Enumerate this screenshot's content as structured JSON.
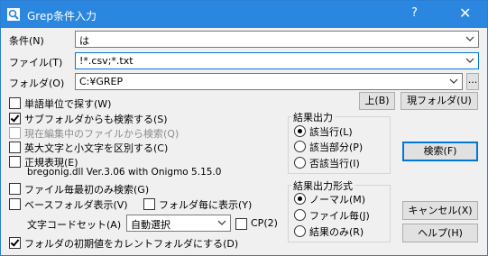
{
  "window": {
    "title": "Grep条件入力",
    "help_glyph": "?",
    "close_glyph": "✕",
    "accent": "#2b86e0"
  },
  "fields": {
    "condition_label": "条件(N)",
    "condition_value": "は",
    "file_label": "ファイル(T)",
    "file_value": "!*.csv;*.txt",
    "folder_label": "フォルダ(O)",
    "folder_value": "C:¥GREP",
    "browse_label": "..."
  },
  "buttons": {
    "up": "上(B)",
    "current_folder": "現フォルダ(U)",
    "search": "検索(F)",
    "cancel": "キャンセル(X)",
    "help": "ヘルプ(H)"
  },
  "options": {
    "word_unit": {
      "label": "単語単位で探す(W)",
      "checked": false
    },
    "subfolder": {
      "label": "サブフォルダからも検索する(S)",
      "checked": true
    },
    "from_editing": {
      "label": "現在編集中のファイルから検索(Q)",
      "checked": false,
      "disabled": true
    },
    "case": {
      "label": "英大文字と小文字を区別する(C)",
      "checked": false
    },
    "regex": {
      "label": "正規表現(E)",
      "checked": false
    },
    "regex_lib": "bregonig.dll Ver.3.06 with Onigmo 5.15.0",
    "first_match": {
      "label": "ファイル毎最初のみ検索(G)",
      "checked": false
    },
    "base_folder": {
      "label": "ベースフォルダ表示(V)",
      "checked": false
    },
    "per_folder": {
      "label": "フォルダ毎に表示(Y)",
      "checked": false
    },
    "charset_label": "文字コードセット(A)",
    "charset_value": "自動選択",
    "cp": {
      "label": "CP(2)",
      "checked": false
    },
    "initial_current": {
      "label": "フォルダの初期値をカレントフォルダにする(D)",
      "checked": true
    }
  },
  "result_output": {
    "title": "結果出力",
    "items": [
      {
        "label": "該当行(L)",
        "selected": true
      },
      {
        "label": "該当部分(P)",
        "selected": false
      },
      {
        "label": "否該当行(I)",
        "selected": false
      }
    ]
  },
  "result_format": {
    "title": "結果出力形式",
    "items": [
      {
        "label": "ノーマル(M)",
        "selected": true
      },
      {
        "label": "ファイル毎(J)",
        "selected": false
      },
      {
        "label": "結果のみ(R)",
        "selected": false
      }
    ]
  }
}
